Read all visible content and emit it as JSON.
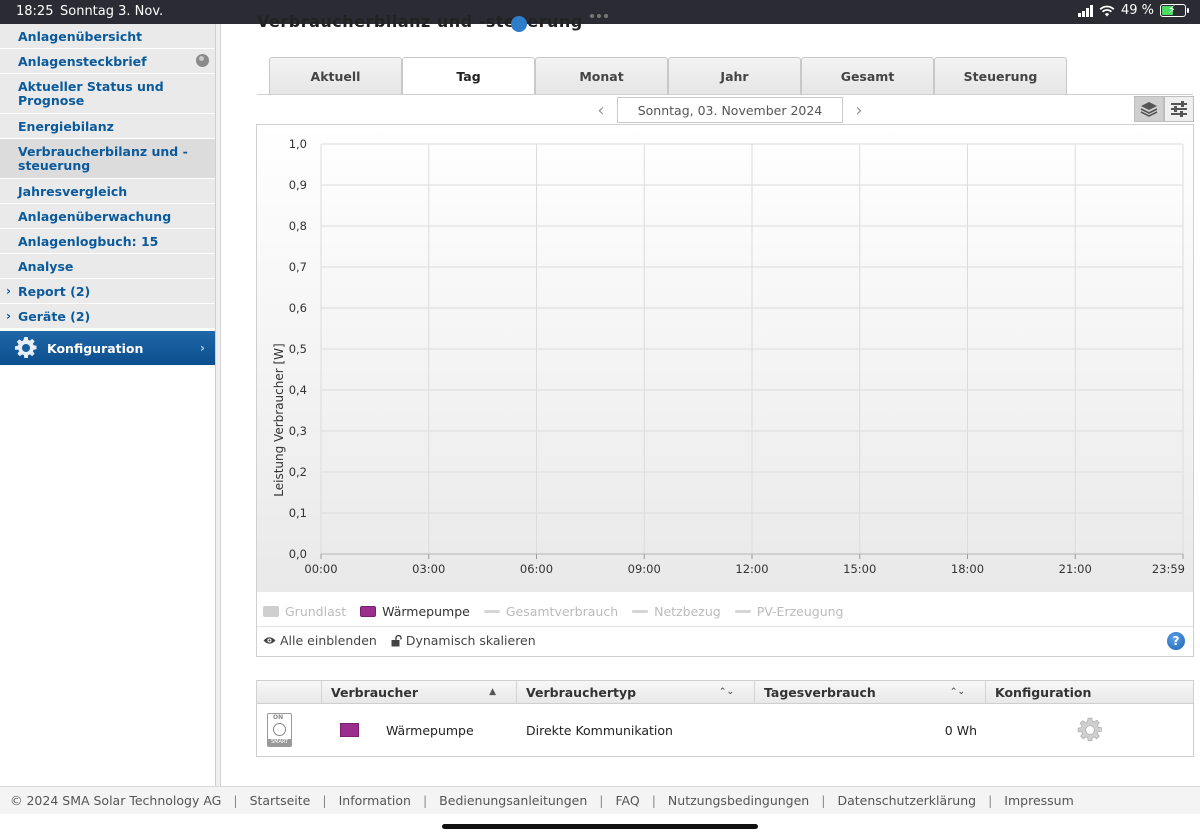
{
  "statusbar": {
    "time": "18:25",
    "date": "Sonntag 3. Nov.",
    "battery": "49 %"
  },
  "page": {
    "heading": "Verbraucherbilanz und -steuerung"
  },
  "sidebar": {
    "items": [
      {
        "label": "Anlagenübersicht"
      },
      {
        "label": "Anlagensteckbrief"
      },
      {
        "label": "Aktueller Status und Prognose"
      },
      {
        "label": "Energiebilanz"
      },
      {
        "label": "Verbraucherbilanz und -steuerung"
      },
      {
        "label": "Jahresvergleich"
      },
      {
        "label": "Anlagenüberwachung"
      },
      {
        "label": "Anlagenlogbuch: 15"
      },
      {
        "label": "Analyse"
      },
      {
        "label": "Report (2)"
      },
      {
        "label": "Geräte (2)"
      }
    ],
    "konfiguration": "Konfiguration"
  },
  "tabs": [
    "Aktuell",
    "Tag",
    "Monat",
    "Jahr",
    "Gesamt",
    "Steuerung"
  ],
  "datenav": {
    "date": "Sonntag, 03. November 2024"
  },
  "chart_data": {
    "type": "area",
    "ylabel": "Leistung Verbraucher [W]",
    "yticks": [
      "1,0",
      "0,9",
      "0,8",
      "0,7",
      "0,6",
      "0,5",
      "0,4",
      "0,3",
      "0,2",
      "0,1",
      "0,0"
    ],
    "ylim": [
      0,
      1
    ],
    "xticks": [
      "00:00",
      "03:00",
      "06:00",
      "09:00",
      "12:00",
      "15:00",
      "18:00",
      "21:00",
      "23:59"
    ],
    "grid": true,
    "series": []
  },
  "legend": {
    "items": [
      {
        "label": "Grundlast",
        "kind": "box",
        "color": "#cccccc",
        "active": false
      },
      {
        "label": "Wärmepumpe",
        "kind": "box",
        "color": "#9b2d8c",
        "active": true
      },
      {
        "label": "Gesamtverbrauch",
        "kind": "line",
        "color": "#d6d6d6",
        "active": false
      },
      {
        "label": "Netzbezug",
        "kind": "line",
        "color": "#d6d6d6",
        "active": false
      },
      {
        "label": "PV-Erzeugung",
        "kind": "line",
        "color": "#d6d6d6",
        "active": false
      }
    ]
  },
  "options": {
    "show_all": "Alle einblenden",
    "dynamic_scale": "Dynamisch skalieren"
  },
  "table": {
    "headers": [
      "Verbraucher",
      "Verbrauchertyp",
      "Tagesverbrauch",
      "Konfiguration"
    ],
    "icon_top": "ON",
    "icon_bottom": "SMART",
    "rows": [
      {
        "name": "Wärmepumpe",
        "type": "Direkte Kommunikation",
        "daily": "0 Wh",
        "color": "#9b2d8c"
      }
    ]
  },
  "footer": {
    "copyright": "© 2024 SMA Solar Technology AG",
    "links": [
      "Startseite",
      "Information",
      "Bedienungsanleitungen",
      "FAQ",
      "Nutzungsbedingungen",
      "Datenschutzerklärung",
      "Impressum"
    ]
  }
}
